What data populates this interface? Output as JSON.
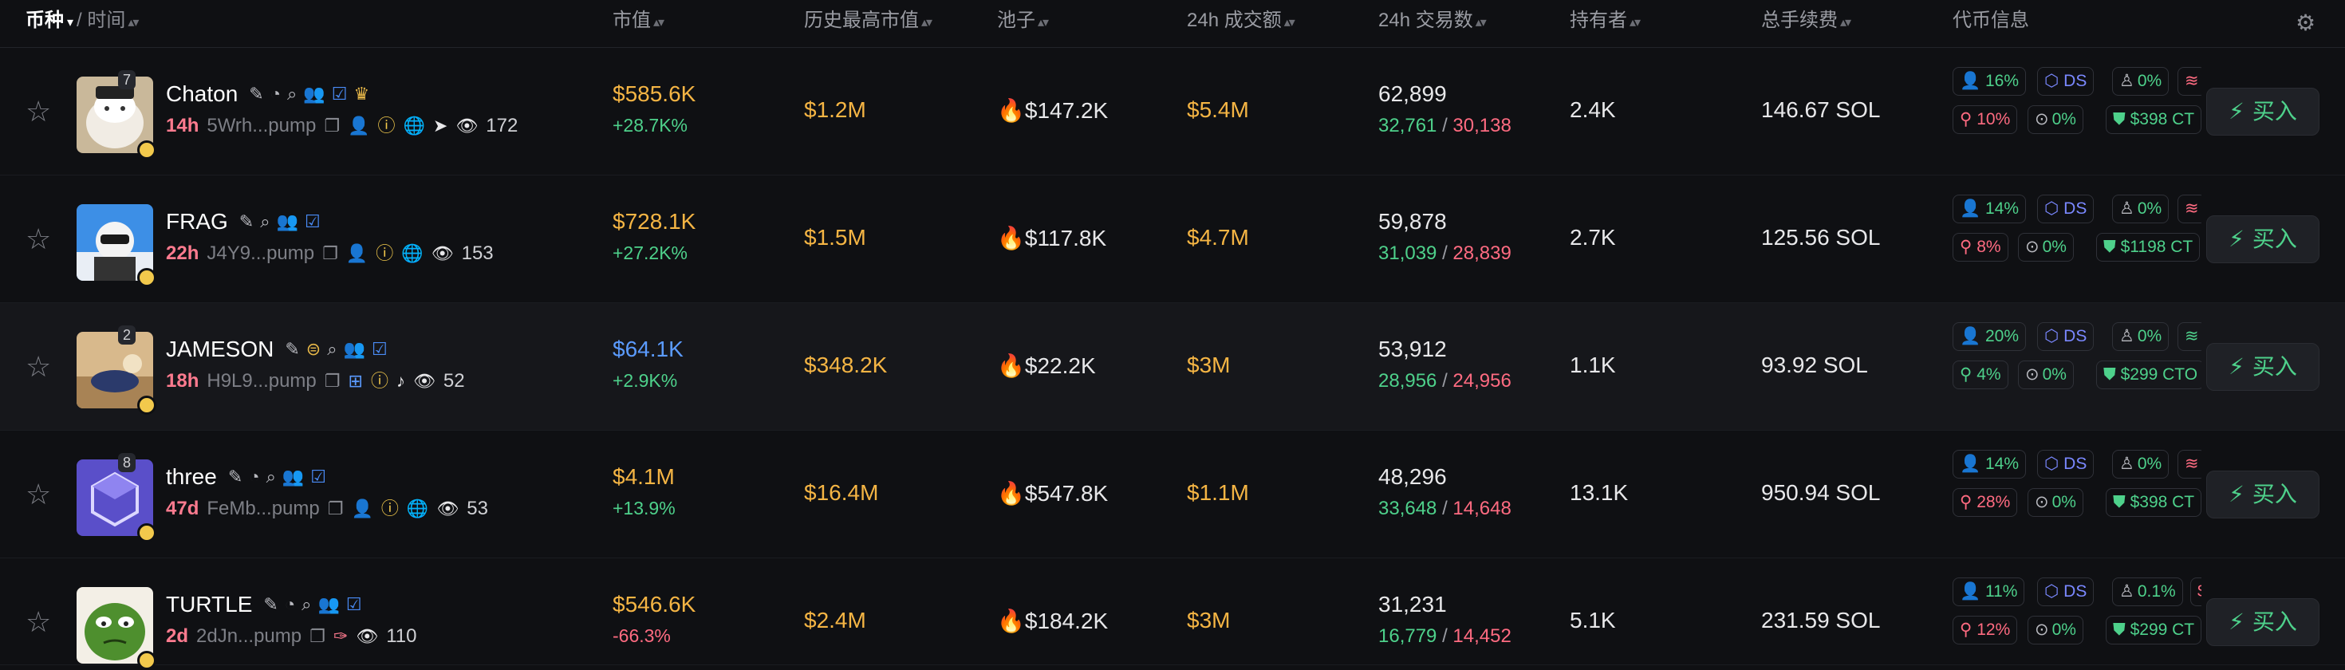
{
  "header": {
    "token": "币种",
    "token_caret": "▾",
    "slash": "/",
    "time": "时间",
    "sort": "▴▾",
    "market_cap": "市值",
    "ath_market_cap": "历史最高市值",
    "pool": "池子",
    "volume_24h": "24h 成交额",
    "tx_24h": "24h 交易数",
    "holders": "持有者",
    "total_fees": "总手续费",
    "token_info": "代币信息",
    "settings_icon": "gear-icon"
  },
  "colors": {
    "accent_green": "#4ed18b",
    "accent_red": "#ff6b81",
    "accent_gold": "#f5b544",
    "accent_blue": "#5b9bff",
    "background": "#0f1013"
  },
  "buy_label": "买入",
  "rows": [
    {
      "name": "Chaton",
      "badge": "7",
      "age": "14h",
      "address": "5Wrh...pump",
      "views": "172",
      "market_cap": "$585.6K",
      "change": "+28.7K%",
      "ath": "$1.2M",
      "pool": "$147.2K",
      "volume": "$5.4M",
      "tx": "62,899",
      "buys": "32,761",
      "sells": "30,138",
      "holders": "2.4K",
      "fees": "146.67 SOL",
      "top10": "16%",
      "dev": "10%",
      "ds": "DS",
      "snipers": "0%",
      "insiders": "0%",
      "paid": "$398 CT"
    },
    {
      "name": "FRAG",
      "badge": "",
      "age": "22h",
      "address": "J4Y9...pump",
      "views": "153",
      "market_cap": "$728.1K",
      "change": "+27.2K%",
      "ath": "$1.5M",
      "pool": "$117.8K",
      "volume": "$4.7M",
      "tx": "59,878",
      "buys": "31,039",
      "sells": "28,839",
      "holders": "2.7K",
      "fees": "125.56 SOL",
      "top10": "14%",
      "dev": "8%",
      "ds": "DS",
      "snipers": "0%",
      "insiders": "0%",
      "paid": "$1198 CT"
    },
    {
      "name": "JAMESON",
      "badge": "2",
      "age": "18h",
      "address": "H9L9...pump",
      "views": "52",
      "market_cap": "$64.1K",
      "change": "+2.9K%",
      "ath": "$348.2K",
      "pool": "$22.2K",
      "volume": "$3M",
      "tx": "53,912",
      "buys": "28,956",
      "sells": "24,956",
      "holders": "1.1K",
      "fees": "93.92 SOL",
      "top10": "20%",
      "dev": "4%",
      "ds": "DS",
      "snipers": "0%",
      "insiders": "0%",
      "paid": "$299 CTO"
    },
    {
      "name": "three",
      "badge": "8",
      "age": "47d",
      "address": "FeMb...pump",
      "views": "53",
      "market_cap": "$4.1M",
      "change": "+13.9%",
      "ath": "$16.4M",
      "pool": "$547.8K",
      "volume": "$1.1M",
      "tx": "48,296",
      "buys": "33,648",
      "sells": "14,648",
      "holders": "13.1K",
      "fees": "950.94 SOL",
      "top10": "14%",
      "dev": "28%",
      "ds": "DS",
      "snipers": "0%",
      "insiders": "0%",
      "paid": "$398 CT"
    },
    {
      "name": "TURTLE",
      "badge": "",
      "age": "2d",
      "address": "2dJn...pump",
      "views": "110",
      "market_cap": "$546.6K",
      "change": "-66.3%",
      "ath": "$2.4M",
      "pool": "$184.2K",
      "volume": "$3M",
      "tx": "31,231",
      "buys": "16,779",
      "sells": "14,452",
      "holders": "5.1K",
      "fees": "231.59 SOL",
      "top10": "11%",
      "dev": "12%",
      "ds": "DS",
      "snipers": "0.1%",
      "insiders": "0%",
      "paid": "$299 CT"
    }
  ]
}
